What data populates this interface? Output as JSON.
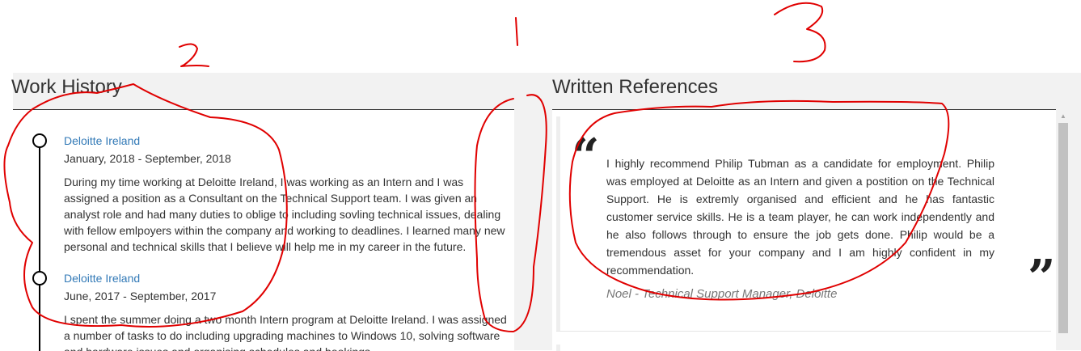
{
  "work_history": {
    "title": "Work History",
    "jobs": [
      {
        "company": "Deloitte Ireland",
        "dates": "January, 2018 - September, 2018",
        "description": "During my time working at Deloitte Ireland, I was working as an Intern and I was assigned a position as a Consultant on the Technical Support team. I was given an analyst role and had many duties to oblige to including sovling technical issues, dealing with fellow emlpoyers within the company and working to deadlines. I learned many new personal and technical skills that I believe will help me in my career in the future."
      },
      {
        "company": "Deloitte Ireland",
        "dates": "June, 2017 - September, 2017",
        "description": "I spent the summer doing a two month Intern program at Deloitte Ireland. I was assigned a number of tasks to do including upgrading machines to Windows 10, solving software and hardware issues and organising schedules and bookings."
      }
    ]
  },
  "written_references": {
    "title": "Written References",
    "references": [
      {
        "text": "I highly recommend Philip Tubman as a candidate for employment. Philip was employed at Deloitte as an Intern and given a postition on the Technical Support. He is extremly organised and efficient and he has fantastic customer service skills. He is a team player, he can work independently and he also follows through to ensure the job gets done. Philip would be a tremendous asset for your company and I am highly confident in my recommendation.",
        "author": "Noel - Technical Support Manager, Deloitte"
      }
    ]
  },
  "quote_marks": {
    "open": "“",
    "close": "”"
  },
  "annotations": {
    "mark_1": "1",
    "mark_2": "2",
    "mark_3": "3",
    "color": "#e00000"
  }
}
